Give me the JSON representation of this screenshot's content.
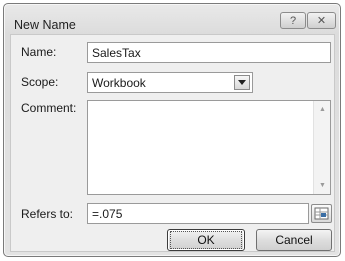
{
  "window": {
    "title": "New Name",
    "help_label": "?",
    "close_label": "✕"
  },
  "form": {
    "name_label": "Name:",
    "name_value": "SalesTax",
    "scope_label": "Scope:",
    "scope_value": "Workbook",
    "comment_label": "Comment:",
    "comment_value": "",
    "refers_to_label": "Refers to:",
    "refers_to_value": "=.075"
  },
  "buttons": {
    "ok_label": "OK",
    "cancel_label": "Cancel"
  },
  "icons": {
    "help": "question-mark-icon",
    "close": "close-icon",
    "dropdown": "chevron-down-icon",
    "scroll_up": "scroll-up-arrow-icon",
    "scroll_down": "scroll-down-arrow-icon",
    "range_picker": "collapse-dialog-icon"
  }
}
